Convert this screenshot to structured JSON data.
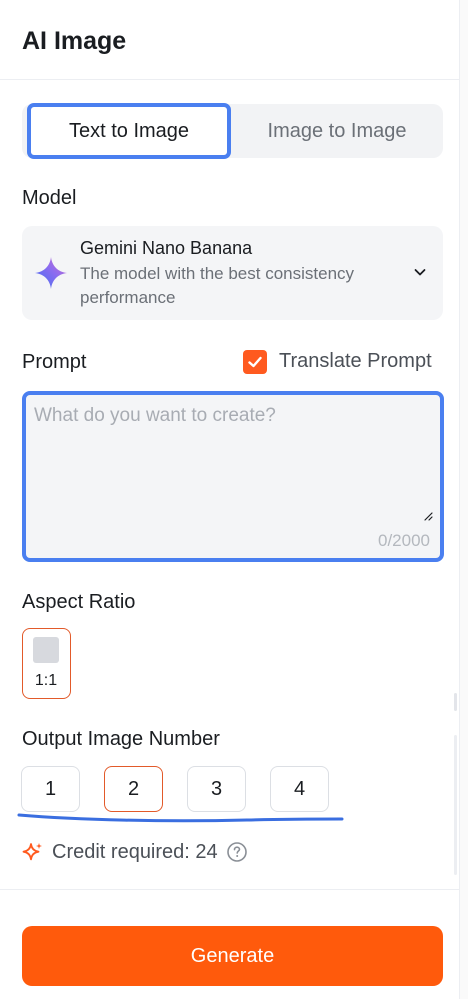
{
  "header": {
    "title": "AI Image"
  },
  "mode_tabs": [
    {
      "label": "Text to Image",
      "active": true
    },
    {
      "label": "Image to Image",
      "active": false
    }
  ],
  "model": {
    "section_label": "Model",
    "name": "Gemini Nano Banana",
    "description": "The model with the best consistency performance",
    "icon": "gemini-sparkle-icon"
  },
  "prompt": {
    "section_label": "Prompt",
    "translate_label": "Translate Prompt",
    "translate_checked": true,
    "placeholder": "What do you want to create?",
    "value": "",
    "char_count": "0/2000"
  },
  "aspect_ratio": {
    "section_label": "Aspect Ratio",
    "options": [
      {
        "label": "1:1",
        "selected": true
      }
    ]
  },
  "output_number": {
    "section_label": "Output Image Number",
    "options": [
      "1",
      "2",
      "3",
      "4"
    ],
    "selected": "2"
  },
  "credit": {
    "text": "Credit required: 24",
    "icon": "sparkle-credit-icon",
    "help_icon": "question-circle-icon"
  },
  "actions": {
    "generate_label": "Generate"
  },
  "colors": {
    "accent": "#ff5a0c",
    "focus_blue": "#4a7ff0",
    "selected_border": "#e25a2a"
  }
}
